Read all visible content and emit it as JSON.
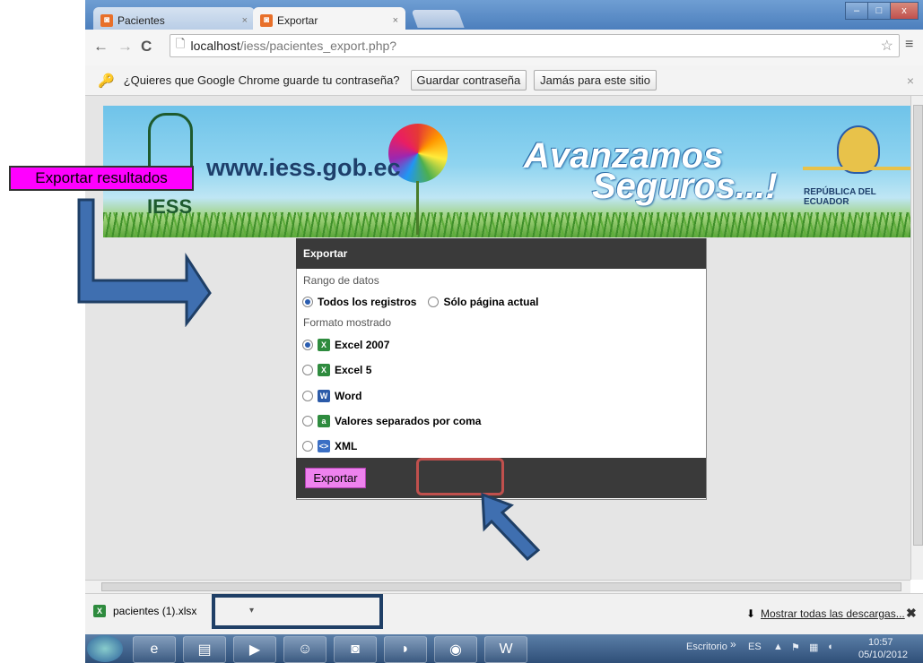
{
  "browser": {
    "tabs": [
      {
        "label": "Pacientes",
        "close": "×"
      },
      {
        "label": "Exportar",
        "close": "×"
      }
    ],
    "window_buttons": [
      "–",
      "□",
      "x"
    ],
    "url_host": "localhost",
    "url_path": "/iess/pacientes_export.php?",
    "star": "☆",
    "menu": "≡"
  },
  "infobar": {
    "prompt": "¿Quieres que Google Chrome guarde tu contraseña?",
    "save_label": "Guardar contraseña",
    "never_label": "Jamás para este sitio",
    "close": "×"
  },
  "banner": {
    "url": "www.iess.gob.ec",
    "slogan_line1": "Avanzamos",
    "slogan_line2": "Seguros...!",
    "country": "REPÚBLICA DEL ECUADOR",
    "logo_text": "IESS"
  },
  "annotation": {
    "callout": "Exportar resultados"
  },
  "dialog": {
    "title": "Exportar",
    "range_label": "Rango de datos",
    "range_options": [
      {
        "label": "Todos los registros",
        "checked": true
      },
      {
        "label": "Sólo página actual",
        "checked": false
      }
    ],
    "format_label": "Formato mostrado",
    "formats": [
      {
        "label": "Excel 2007",
        "checked": true,
        "icon": "excel-icon",
        "color": "#2e8b3e"
      },
      {
        "label": "Excel 5",
        "checked": false,
        "icon": "excel-icon",
        "color": "#2e8b3e"
      },
      {
        "label": "Word",
        "checked": false,
        "icon": "word-icon",
        "color": "#2b5aa8"
      },
      {
        "label": "Valores separados por coma",
        "checked": false,
        "icon": "csv-icon",
        "color": "#2e8b3e"
      },
      {
        "label": "XML",
        "checked": false,
        "icon": "xml-icon",
        "color": "#3b6fc4"
      }
    ],
    "export_button": "Exportar"
  },
  "downloads": {
    "file": "pacientes (1).xlsx",
    "show_all": "Mostrar todas las descargas...",
    "close": "✖"
  },
  "taskbar": {
    "desktop_label": "Escritorio",
    "lang": "ES",
    "time": "10:57",
    "date": "05/10/2012"
  }
}
